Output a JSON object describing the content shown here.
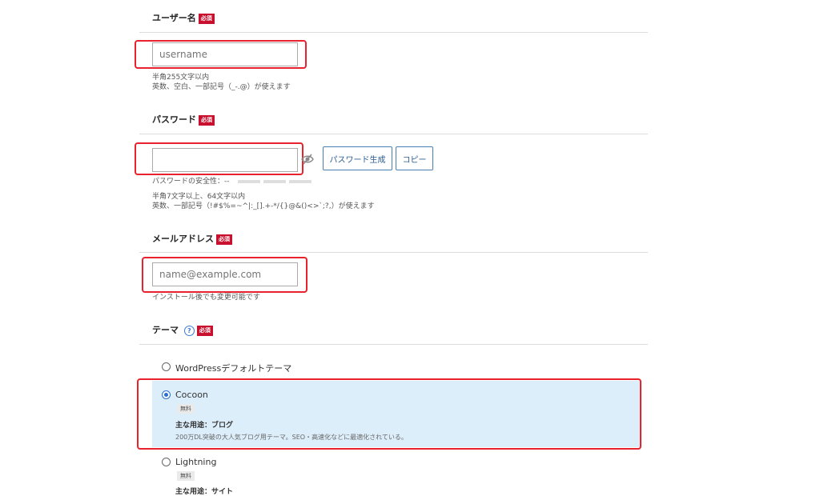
{
  "username": {
    "label": "ユーザー名",
    "required": "必須",
    "placeholder": "username",
    "help1": "半角255文字以内",
    "help2": "英数、空白、一部記号（_-.@）が使えます"
  },
  "password": {
    "label": "パスワード",
    "required": "必須",
    "value": "",
    "generate_button": "パスワード生成",
    "copy_button": "コピー",
    "strength": "パスワードの安全性：--",
    "help1": "半角7文字以上、64文字以内",
    "help2": "英数、一部記号（!#$%=~^|:_[].+-*/{}@&()<>`;?,）が使えます"
  },
  "email": {
    "label": "メールアドレス",
    "required": "必須",
    "placeholder": "name@example.com",
    "help": "インストール後でも変更可能です"
  },
  "theme": {
    "label": "テーマ",
    "help_icon": "?",
    "required": "必須",
    "options": [
      {
        "name": "WordPressデフォルトテーマ",
        "selected": false
      },
      {
        "name": "Cocoon",
        "selected": true,
        "tag": "無料",
        "use": "主な用途：ブログ",
        "desc": "200万DL突破の大人気ブログ用テーマ。SEO・高速化などに最適化されている。"
      },
      {
        "name": "Lightning",
        "selected": false,
        "tag": "無料",
        "use": "主な用途：サイト"
      }
    ]
  },
  "colors": {
    "required_bg": "#c8102e",
    "highlight": "#e8232d",
    "selected_bg": "#ddeefb",
    "button_border": "#4a7fb3"
  }
}
